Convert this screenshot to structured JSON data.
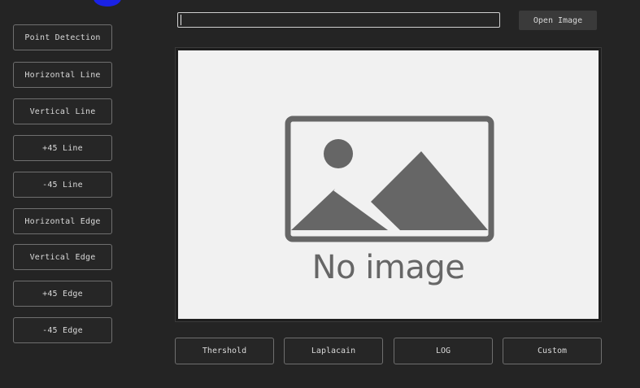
{
  "sidebar": {
    "buttons": [
      {
        "label": "Point Detection"
      },
      {
        "label": "Horizontal Line"
      },
      {
        "label": "Vertical Line"
      },
      {
        "label": "+45 Line"
      },
      {
        "label": "-45 Line"
      },
      {
        "label": "Horizontal Edge"
      },
      {
        "label": "Vertical Edge"
      },
      {
        "label": "+45 Edge"
      },
      {
        "label": "-45 Edge"
      }
    ]
  },
  "toolbar": {
    "path_value": "",
    "open_label": "Open Image"
  },
  "preview": {
    "placeholder_text": "No image"
  },
  "bottom": {
    "buttons": [
      {
        "label": "Thershold"
      },
      {
        "label": "Laplacain"
      },
      {
        "label": "LOG"
      },
      {
        "label": "Custom"
      }
    ]
  },
  "colors": {
    "background": "#242424",
    "button_border": "#6f6f6f",
    "placeholder_bg": "#f1f1f1",
    "placeholder_icon": "#666666",
    "accent_dot": "#1a22e6"
  }
}
